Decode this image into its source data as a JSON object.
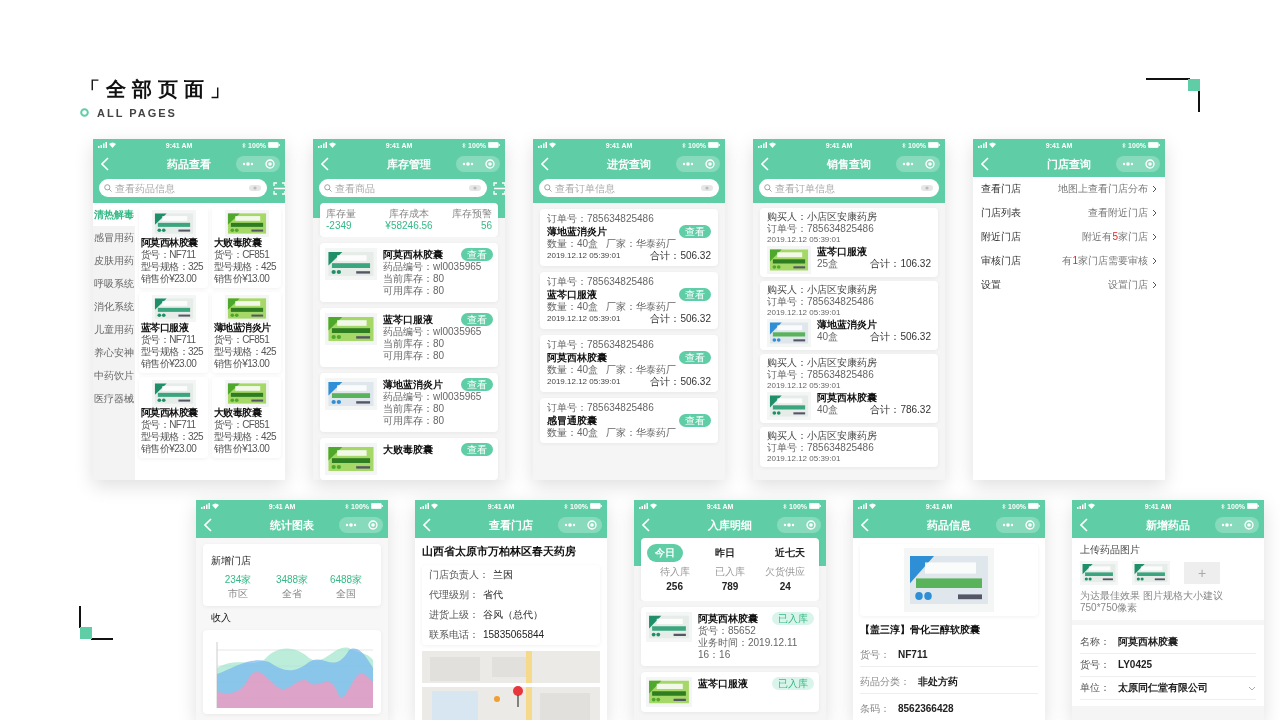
{
  "header": {
    "title": "「全部页面」",
    "subtitle": "ALL PAGES"
  },
  "phones": [
    {
      "kind": "catalog",
      "time": "9:41 AM",
      "battery": "100%",
      "title": "药品查看",
      "search": {
        "placeholder": "查看药品信息"
      },
      "categories": [
        {
          "label": "清热解毒",
          "selected": true
        },
        {
          "label": "感冒用药",
          "selected": false
        },
        {
          "label": "皮肤用药",
          "selected": false
        },
        {
          "label": "呼吸系统",
          "selected": false
        },
        {
          "label": "消化系统",
          "selected": false
        },
        {
          "label": "儿童用药",
          "selected": false
        },
        {
          "label": "养心安神",
          "selected": false
        },
        {
          "label": "中药饮片",
          "selected": false
        },
        {
          "label": "医疗器械",
          "selected": false
        }
      ],
      "products": [
        {
          "name": "阿莫西林胶囊",
          "code": "货号：NF711",
          "spec": "型号规格：325",
          "price": "销售价¥23.00"
        },
        {
          "name": "大败毒胶囊",
          "code": "货号：CF851",
          "spec": "型号规格：425",
          "price": "销售价¥13.00"
        },
        {
          "name": "蓝芩口服液",
          "code": "货号：NF711",
          "spec": "型号规格：325",
          "price": "销售价¥23.00"
        },
        {
          "name": "薄地蓝消炎片",
          "code": "货号：CF851",
          "spec": "型号规格：425",
          "price": "销售价¥13.00"
        },
        {
          "name": "阿莫西林胶囊",
          "code": "货号：NF711",
          "spec": "型号规格：325",
          "price": "销售价¥23.00"
        },
        {
          "name": "大败毒胶囊",
          "code": "货号：CF851",
          "spec": "型号规格：425",
          "price": "销售价¥13.00"
        }
      ]
    },
    {
      "kind": "stock",
      "time": "9:41 AM",
      "battery": "100%",
      "title": "库存管理",
      "search": {
        "placeholder": "查看商品"
      },
      "summary": [
        {
          "label": "库存量",
          "value": "-2349"
        },
        {
          "label": "库存成本",
          "value": "¥58246.56"
        },
        {
          "label": "库存预警",
          "value": "56"
        }
      ],
      "items": [
        {
          "name": "阿莫西林胶囊",
          "button": "查看",
          "code": "药品编号：wl0035965",
          "current": "当前库存：80",
          "available": "可用库存：80"
        },
        {
          "name": "蓝芩口服液",
          "button": "查看",
          "code": "药品编号：wl0035965",
          "current": "当前库存：80",
          "available": "可用库存：80"
        },
        {
          "name": "薄地蓝消炎片",
          "button": "查看",
          "code": "药品编号：wl0035965",
          "current": "当前库存：80",
          "available": "可用库存：80"
        },
        {
          "name": "大败毒胶囊",
          "button": "查看"
        }
      ]
    },
    {
      "kind": "purchase",
      "time": "9:41 AM",
      "battery": "100%",
      "title": "进货查询",
      "search": {
        "placeholder": "查看订单信息"
      },
      "orders": [
        {
          "order": "订单号：785634825486",
          "name": "薄地蓝消炎片",
          "button": "查看",
          "qty": "数量：40盒",
          "maker": "厂家：华泰药厂",
          "date": "2019.12.12 05:39:01",
          "total": "合计：506.32"
        },
        {
          "order": "订单号：785634825486",
          "name": "蓝芩口服液",
          "button": "查看",
          "qty": "数量：40盒",
          "maker": "厂家：华泰药厂",
          "date": "2019.12.12 05:39:01",
          "total": "合计：506.32"
        },
        {
          "order": "订单号：785634825486",
          "name": "阿莫西林胶囊",
          "button": "查看",
          "qty": "数量：40盒",
          "maker": "厂家：华泰药厂",
          "date": "2019.12.12 05:39:01",
          "total": "合计：506.32"
        },
        {
          "order": "订单号：785634825486",
          "name": "感冒通胶囊",
          "button": "查看",
          "qty": "数量：40盒",
          "maker": "厂家：华泰药厂"
        }
      ]
    },
    {
      "kind": "sales",
      "time": "9:41 AM",
      "battery": "100%",
      "title": "销售查询",
      "search": {
        "placeholder": "查看订单信息"
      },
      "sales": [
        {
          "buyer": "购买人：小店区安康药房",
          "order": "订单号：785634825486",
          "date": "2019.12.12 05:39:01",
          "name": "蓝芩口服液",
          "qty": "25盒",
          "total": "合计：106.32"
        },
        {
          "buyer": "购买人：小店区安康药房",
          "order": "订单号：785634825486",
          "date": "2019.12.12 05:39:01",
          "name": "薄地蓝消炎片",
          "qty": "40盒",
          "total": "合计：506.32"
        },
        {
          "buyer": "购买人：小店区安康药房",
          "order": "订单号：785634825486",
          "date": "2019.12.12 05:39:01",
          "name": "阿莫西林胶囊",
          "qty": "40盒",
          "total": "合计：786.32"
        },
        {
          "buyer": "购买人：小店区安康药房",
          "order": "订单号：785634825486",
          "date": "2019.12.12 05:39:01"
        }
      ]
    },
    {
      "kind": "stores",
      "time": "9:41 AM",
      "battery": "100%",
      "title": "门店查询",
      "rows": [
        {
          "label": "查看门店",
          "hint": "地图上查看门店分布"
        },
        {
          "label": "门店列表",
          "hint": "查看附近门店"
        },
        {
          "label": "附近门店",
          "hint": "附近有**5**家门店"
        },
        {
          "label": "审核门店",
          "hint": "有**1**家门店需要审核"
        },
        {
          "label": "设置",
          "hint": "设置门店"
        }
      ]
    },
    {
      "kind": "stats",
      "time": "9:41 AM",
      "battery": "100%",
      "title": "统计图表",
      "card_title": "新增门店",
      "stats": [
        {
          "value": "234家",
          "label": "市区"
        },
        {
          "value": "3488家",
          "label": "全省"
        },
        {
          "value": "6488家",
          "label": "全国"
        }
      ],
      "section": "收入"
    },
    {
      "kind": "store_detail",
      "time": "9:41 AM",
      "battery": "100%",
      "title": "查看门店",
      "name": "山西省太原市万柏林区春天药房",
      "fields": [
        {
          "label": "门店负责人：",
          "value": "兰因"
        },
        {
          "label": "代理级别：",
          "value": "省代"
        },
        {
          "label": "进货上级：",
          "value": "谷风（总代）"
        },
        {
          "label": "联系电话：",
          "value": "15835065844"
        }
      ],
      "map": {
        "kind": "picture"
      }
    },
    {
      "kind": "inbound",
      "time": "9:41 AM",
      "battery": "100%",
      "title": "入库明细",
      "tabs": [
        {
          "label": "今日",
          "selected": true
        },
        {
          "label": "昨日",
          "selected": false
        },
        {
          "label": "近七天",
          "selected": false
        }
      ],
      "stats": [
        {
          "label": "待入库",
          "value": "256"
        },
        {
          "label": "已入库",
          "value": "789"
        },
        {
          "label": "欠货供应",
          "value": "24"
        }
      ],
      "items": [
        {
          "name": "阿莫西林胶囊",
          "status": "已入库",
          "code": "货号：85652",
          "time": "业务时间：2019.12.11 16：16"
        },
        {
          "name": "蓝芩口服液",
          "status": "已入库"
        }
      ]
    },
    {
      "kind": "drug_info",
      "time": "9:41 AM",
      "battery": "100%",
      "title": "药品信息",
      "product": "【盖三淳】骨化三醇软胶囊",
      "fields": [
        {
          "label": "货号：",
          "value": "NF711"
        },
        {
          "label": "药品分类：",
          "value": "非处方药"
        },
        {
          "label": "条码：",
          "value": "8562366428"
        }
      ]
    },
    {
      "kind": "add_drug",
      "time": "9:41 AM",
      "battery": "100%",
      "title": "新增药品",
      "upload_title": "上传药品图片",
      "add": "+",
      "hint": "为达最佳效果 图片规格大小建议750*750像素",
      "fields": [
        {
          "kind": "text",
          "label": "名称：",
          "value": "阿莫西林胶囊"
        },
        {
          "kind": "text",
          "label": "货号：",
          "value": "LY0425"
        },
        {
          "kind": "select",
          "label": "单位：",
          "value": "太原同仁堂有限公司"
        }
      ]
    }
  ]
}
